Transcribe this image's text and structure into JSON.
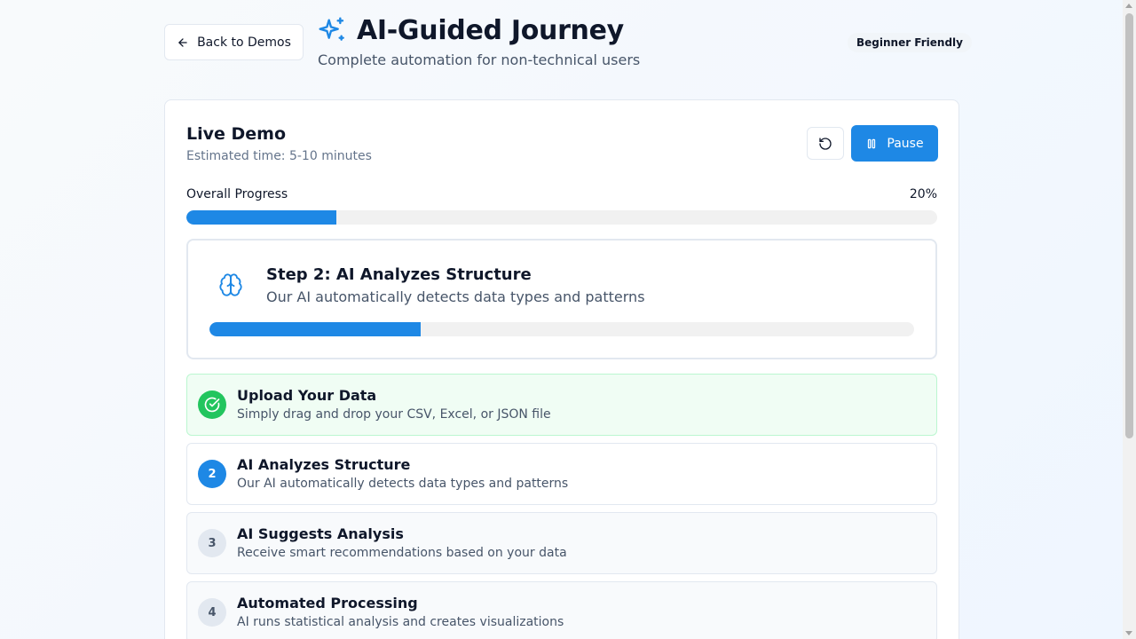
{
  "header": {
    "back_label": "Back to Demos",
    "title": "AI-Guided Journey",
    "subtitle": "Complete automation for non-technical users",
    "badge": "Beginner Friendly"
  },
  "demo": {
    "title": "Live Demo",
    "estimated_time": "Estimated time: 5-10 minutes",
    "pause_label": "Pause",
    "overall_label": "Overall Progress",
    "overall_pct": "20%",
    "overall_fraction": 0.2
  },
  "current_step": {
    "title": "Step 2: AI Analyzes Structure",
    "description": "Our AI automatically detects data types and patterns",
    "progress_fraction": 0.3
  },
  "steps": [
    {
      "number": "1",
      "name": "Upload Your Data",
      "description": "Simply drag and drop your CSV, Excel, or JSON file",
      "status": "done"
    },
    {
      "number": "2",
      "name": "AI Analyzes Structure",
      "description": "Our AI automatically detects data types and patterns",
      "status": "active"
    },
    {
      "number": "3",
      "name": "AI Suggests Analysis",
      "description": "Receive smart recommendations based on your data",
      "status": "pending"
    },
    {
      "number": "4",
      "name": "Automated Processing",
      "description": "AI runs statistical analysis and creates visualizations",
      "status": "pending"
    }
  ],
  "icons": {
    "back": "arrow-left-icon",
    "title": "sparkles-icon",
    "reset": "rotate-ccw-icon",
    "pause": "pause-icon",
    "step": "brain-icon",
    "done": "check-circle-icon"
  },
  "colors": {
    "accent": "#1e88e5",
    "success": "#22c55e",
    "track": "#f1f1f1"
  }
}
